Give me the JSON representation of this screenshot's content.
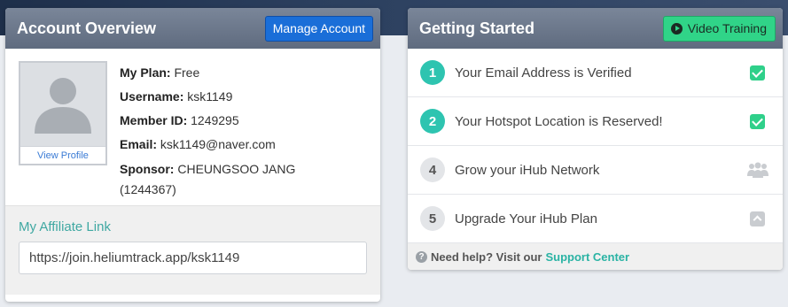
{
  "account": {
    "title": "Account Overview",
    "manage_label": "Manage Account",
    "view_profile": "View Profile",
    "plan_label": "My Plan:",
    "plan_value": "Free",
    "username_label": "Username:",
    "username_value": "ksk1149",
    "member_label": "Member ID:",
    "member_value": "1249295",
    "email_label": "Email:",
    "email_value": "ksk1149@naver.com",
    "sponsor_label": "Sponsor:",
    "sponsor_value": "CHEUNGSOO JANG (1244367)",
    "affiliate_title": "My Affiliate Link",
    "affiliate_url": "https://join.heliumtrack.app/ksk1149"
  },
  "started": {
    "title": "Getting Started",
    "video_label": "Video Training",
    "steps": [
      {
        "num": "1",
        "label": "Your Email Address is Verified",
        "status": "done",
        "icon": "check-icon"
      },
      {
        "num": "2",
        "label": "Your Hotspot Location is Reserved!",
        "status": "done",
        "icon": "check-icon"
      },
      {
        "num": "4",
        "label": "Grow your iHub Network",
        "status": "todo",
        "icon": "people-icon"
      },
      {
        "num": "5",
        "label": "Upgrade Your iHub Plan",
        "status": "todo",
        "icon": "upgrade-icon"
      }
    ],
    "help_text": "Need help? Visit our",
    "help_link": "Support Center"
  },
  "colors": {
    "accent_teal": "#2ec4b0",
    "manage_blue": "#1a6ed8",
    "video_green": "#30d488"
  }
}
